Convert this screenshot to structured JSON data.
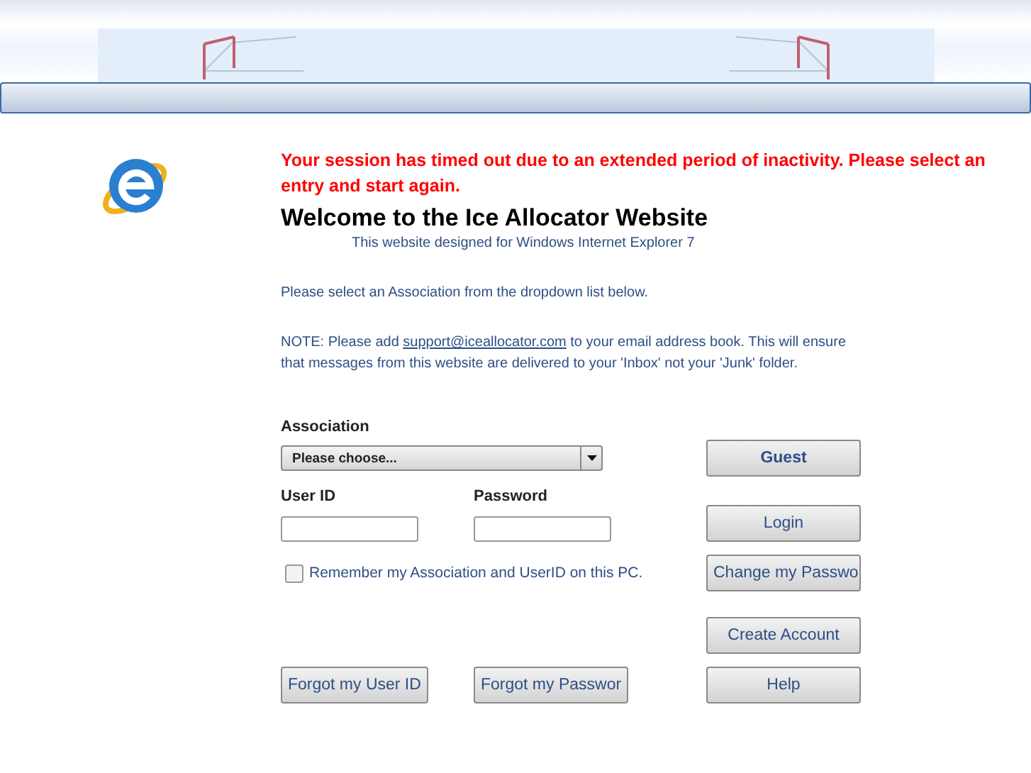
{
  "session_message": "Your session has timed out due to an extended period of inactivity. Please select an entry and start again.",
  "title": "Welcome to the Ice Allocator Website",
  "subtitle": "This website designed for Windows Internet Explorer 7",
  "instruction": "Please select an Association from the dropdown list below.",
  "note": {
    "before": "NOTE: Please add ",
    "link": "support@iceallocator.com",
    "after": " to your email address book. This will ensure that messages from this website are delivered to your 'Inbox' not your 'Junk' folder."
  },
  "form": {
    "association": {
      "label": "Association",
      "value": "Please choose..."
    },
    "user_id": {
      "label": "User ID"
    },
    "password": {
      "label": "Password"
    },
    "remember": {
      "label": "Remember my Association and UserID on this PC.",
      "checked": false
    }
  },
  "side_buttons": [
    {
      "label": "Guest",
      "emphasis": true
    },
    {
      "label": "Login",
      "emphasis": false
    },
    {
      "label": "Change my Passwo",
      "emphasis": false
    },
    {
      "label": "Create Account",
      "emphasis": false
    },
    {
      "label": "Help",
      "emphasis": false
    }
  ],
  "forgot_buttons": [
    {
      "label": "Forgot my User ID"
    },
    {
      "label": "Forgot my Passwor"
    }
  ]
}
